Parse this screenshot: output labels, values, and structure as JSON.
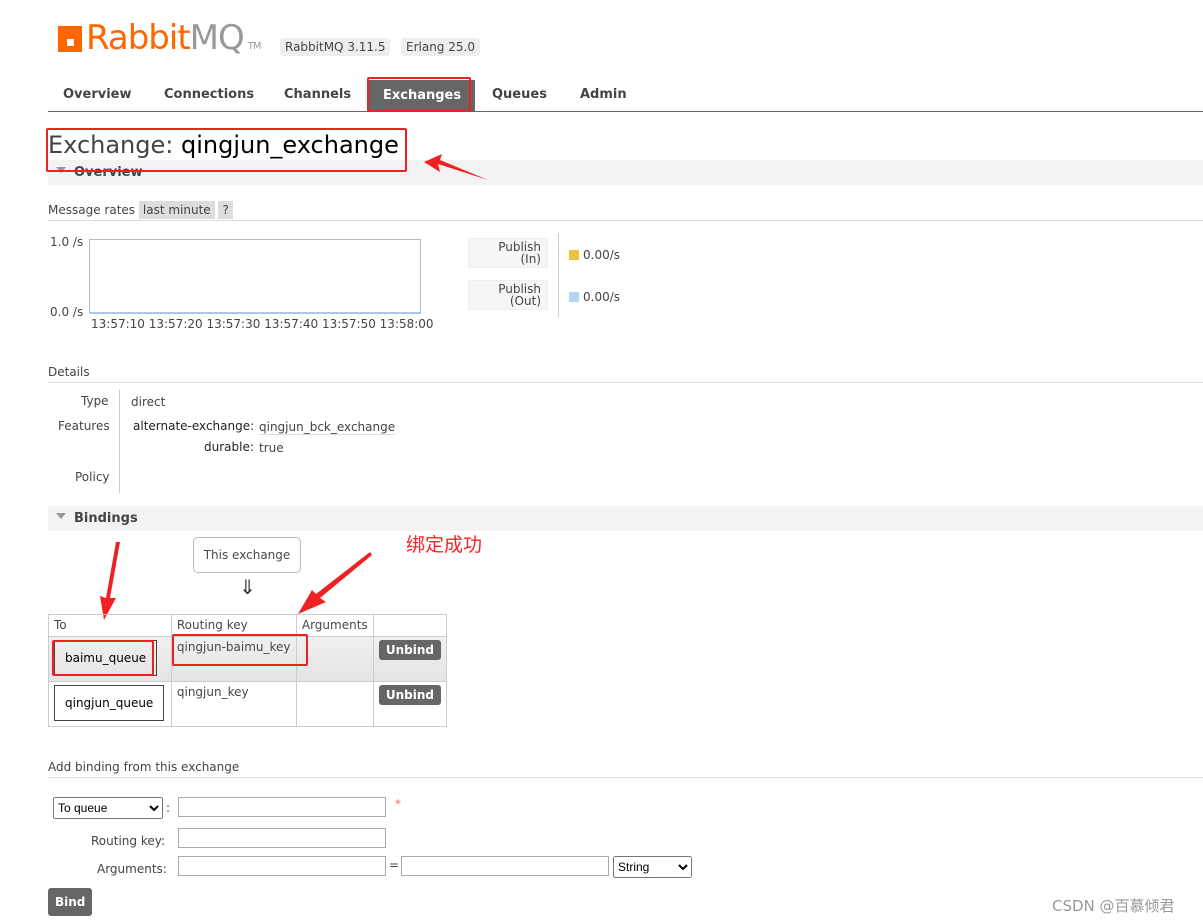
{
  "header": {
    "logo_rabbit": "Rabbit",
    "logo_mq": "MQ",
    "logo_tm": "TM",
    "version": "RabbitMQ 3.11.5",
    "erlang": "Erlang 25.0"
  },
  "nav": [
    {
      "label": "Overview"
    },
    {
      "label": "Connections"
    },
    {
      "label": "Channels"
    },
    {
      "label": "Exchanges",
      "selected": true
    },
    {
      "label": "Queues"
    },
    {
      "label": "Admin"
    }
  ],
  "page": {
    "title_prefix": "Exchange: ",
    "title_name": "qingjun_exchange"
  },
  "overview": {
    "heading": "Overview",
    "rates_label": "Message rates",
    "range": "last minute",
    "help": "?",
    "y_top": "1.0 /s",
    "y_bottom": "0.0 /s",
    "x_ticks": [
      "13:57:10",
      "13:57:20",
      "13:57:30",
      "13:57:40",
      "13:57:50",
      "13:58:00"
    ],
    "legend": [
      {
        "label1": "Publish",
        "label2": "(In)",
        "value": "0.00/s",
        "color": "#edc240"
      },
      {
        "label1": "Publish",
        "label2": "(Out)",
        "value": "0.00/s",
        "color": "#afd8f8"
      }
    ]
  },
  "details": {
    "heading": "Details",
    "type_label": "Type",
    "type_value": "direct",
    "features_label": "Features",
    "features": [
      {
        "key": "alternate-exchange:",
        "value": "qingjun_bck_exchange"
      },
      {
        "key": "durable:",
        "value": "true"
      }
    ],
    "policy_label": "Policy"
  },
  "bindings": {
    "heading": "Bindings",
    "this_exchange": "This exchange",
    "arrow": "⇓",
    "columns": [
      "To",
      "Routing key",
      "Arguments",
      ""
    ],
    "rows": [
      {
        "to": "baimu_queue",
        "routing_key": "qingjun-baimu_key",
        "arguments": "",
        "action": "Unbind"
      },
      {
        "to": "qingjun_queue",
        "routing_key": "qingjun_key",
        "arguments": "",
        "action": "Unbind"
      }
    ],
    "annotation": "绑定成功"
  },
  "add_binding": {
    "heading": "Add binding from this exchange",
    "dest_type": "To queue",
    "colon": ":",
    "required": "*",
    "routing_key_label": "Routing key:",
    "arguments_label": "Arguments:",
    "equals": "=",
    "arg_type": "String",
    "bind": "Bind"
  },
  "watermark": "CSDN @百慕倾君"
}
